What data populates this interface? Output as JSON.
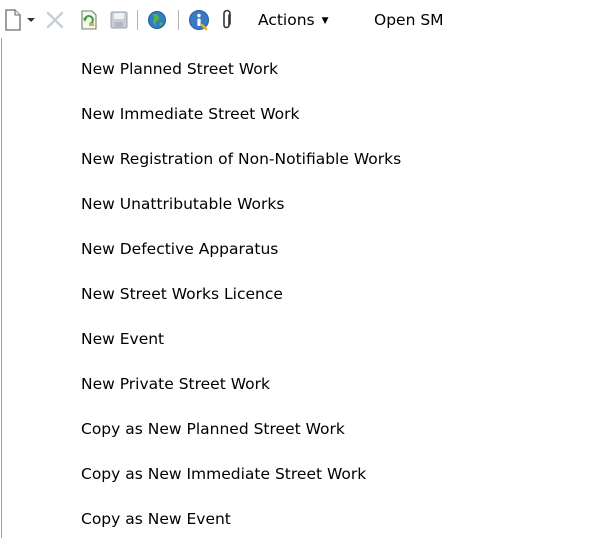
{
  "toolbar": {
    "buttons": [
      {
        "icon": "new-document-icon",
        "has_dropdown": true
      },
      {
        "icon": "delete-x-icon"
      },
      {
        "icon": "refresh-document-icon"
      },
      {
        "icon": "save-disk-icon"
      },
      {
        "icon": "globe-icon"
      },
      {
        "icon": "info-icon"
      },
      {
        "icon": "paperclip-icon"
      }
    ],
    "actions_label": "Actions",
    "open_label": "Open SM"
  },
  "dropdown": {
    "items": [
      {
        "label": "New Planned Street Work"
      },
      {
        "label": "New Immediate Street Work"
      },
      {
        "label": "New Registration of Non-Notifiable Works"
      },
      {
        "label": "New Unattributable Works"
      },
      {
        "label": "New Defective Apparatus"
      },
      {
        "label": "New Street Works Licence"
      },
      {
        "label": "New Event"
      },
      {
        "label": "New Private Street Work"
      },
      {
        "label": "Copy as New Planned Street Work"
      },
      {
        "label": "Copy as New Immediate Street Work"
      },
      {
        "label": "Copy as New Event"
      }
    ]
  },
  "colors": {
    "globe": "#2f7fc1",
    "info": "#3a78c8",
    "disabled_x": "#c7cfd8",
    "refresh_green": "#3c9b3c"
  }
}
